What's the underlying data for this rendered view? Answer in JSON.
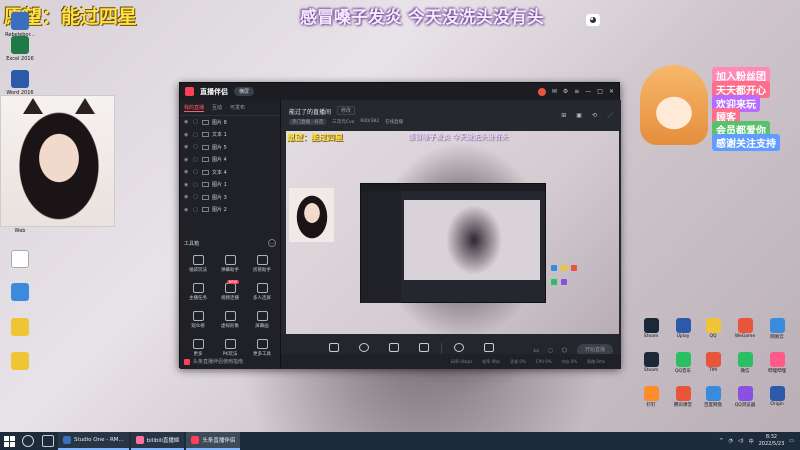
{
  "overlay": {
    "wish_text": "愿望：能过四星",
    "headline": "感冒嗓子发炎 今天没洗头没有头",
    "side_banners": [
      "加入粉丝团",
      "天天都开心",
      "欢迎来玩",
      "顾客",
      "会员都爱你",
      "感谢关注支持"
    ]
  },
  "desktop_left": {
    "icons": [
      "Rebelebor...",
      "Excel 2016",
      "Word 2016",
      "",
      "",
      "",
      "",
      ""
    ],
    "webcam_label": "Web"
  },
  "app": {
    "name": "直播伴侣",
    "mode_button": "横屏",
    "left_tabs": [
      "我的直播",
      "互动",
      "可发布"
    ],
    "layers": [
      "图片 8",
      "文本 1",
      "图片 5",
      "图片 4",
      "文本 4",
      "图片 1",
      "图片 3",
      "图片 2"
    ],
    "tools_header": "工具箱",
    "tools": [
      "福袋玩法",
      "弹幕助手",
      "房管助手",
      "主播任务",
      "视频连播",
      "多人连屏",
      "观众榜",
      "虚拟形象",
      "屏幕画",
      "更多",
      "PK玩法",
      "更多工具"
    ],
    "tool_badge": "NEW",
    "bottom_message": "头条直播伴侣使用指南",
    "topic": "能过了的直播间",
    "topic_edit": "修改",
    "meta_tags": [
      "热门直播 · 抖音",
      "三次元Cvo",
      "600/382",
      "在线直播"
    ],
    "preview_wish": "愿望：能过四星",
    "preview_headline": "感冒嗓子发炎 今天没洗头没有头",
    "bottom_tools": [
      "直播屏幕",
      "摄像头",
      "手机投屏",
      "多媒体",
      "麦克风",
      "扬声器"
    ],
    "golive_label": "开始直播",
    "status_items": [
      "码率 0kbps",
      "帧率 0fps",
      "丢帧 0%",
      "CPU 0%",
      "内存 0%",
      "网络 0ms"
    ]
  },
  "desktop_right": {
    "icons": [
      "Steam",
      "Uplay",
      "QQ",
      "WeGame",
      "网易云",
      "TIM",
      "Steam",
      "QQ音乐",
      "微信",
      "哔哩哔哩",
      "钉钉",
      "腾讯课堂",
      "网易UU",
      "百度网盘",
      "QQ浏览器",
      "Origin",
      "迅雷",
      "YY语音"
    ]
  },
  "taskbar": {
    "tasks": [
      "Studio One - RM...",
      "bilibili直播姬",
      "头条直播伴侣"
    ],
    "tray_time": "8:32",
    "tray_date": "2022/5/23"
  }
}
